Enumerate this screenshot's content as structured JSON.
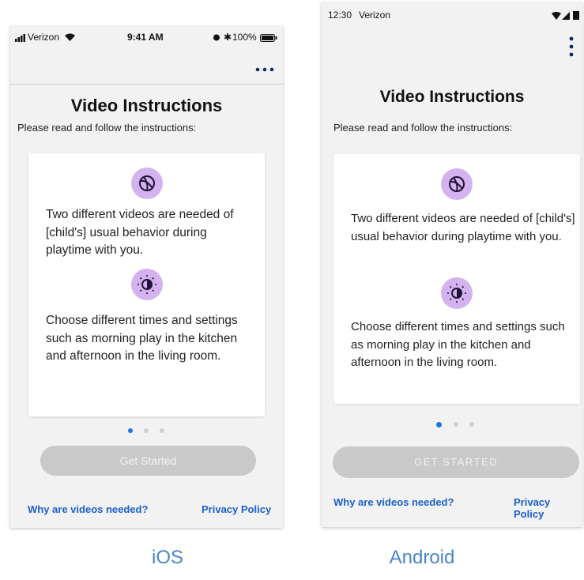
{
  "ios": {
    "status": {
      "carrier": "Verizon",
      "time": "9:41 AM",
      "battery": "100%"
    },
    "menu_icon": "more-horizontal-icon",
    "title": "Video Instructions",
    "subtitle": "Please read and follow the instructions:",
    "instructions": [
      {
        "icon": "ball-icon",
        "text": "Two different videos are needed of [child's] usual behavior during playtime with you."
      },
      {
        "icon": "sun-moon-icon",
        "text": "Choose different times and settings such as morning play in the kitchen and afternoon in the living room."
      }
    ],
    "page_indicator": {
      "count": 3,
      "active": 1
    },
    "button_label": "Get Started",
    "link_why": "Why are videos needed?",
    "link_privacy": "Privacy Policy"
  },
  "android": {
    "status": {
      "time": "12:30",
      "carrier": "Verizon"
    },
    "menu_icon": "more-vertical-icon",
    "title": "Video Instructions",
    "subtitle": "Please read and follow the instructions:",
    "instructions": [
      {
        "icon": "ball-icon",
        "text": "Two different videos are needed of [child's] usual behavior during playtime with you."
      },
      {
        "icon": "sun-moon-icon",
        "text": "Choose different times and settings such as morning play in the kitchen and afternoon in the living room."
      }
    ],
    "page_indicator": {
      "count": 3,
      "active": 1
    },
    "button_label": "GET STARTED",
    "link_why": "Why are videos needed?",
    "link_privacy": "Privacy Policy"
  },
  "captions": {
    "ios": "iOS",
    "android": "Android"
  },
  "colors": {
    "accent": "#1a73e8",
    "icon_bg": "#d4b2ef",
    "button_disabled": "#c9c9c9",
    "link": "#1a5fd0"
  }
}
